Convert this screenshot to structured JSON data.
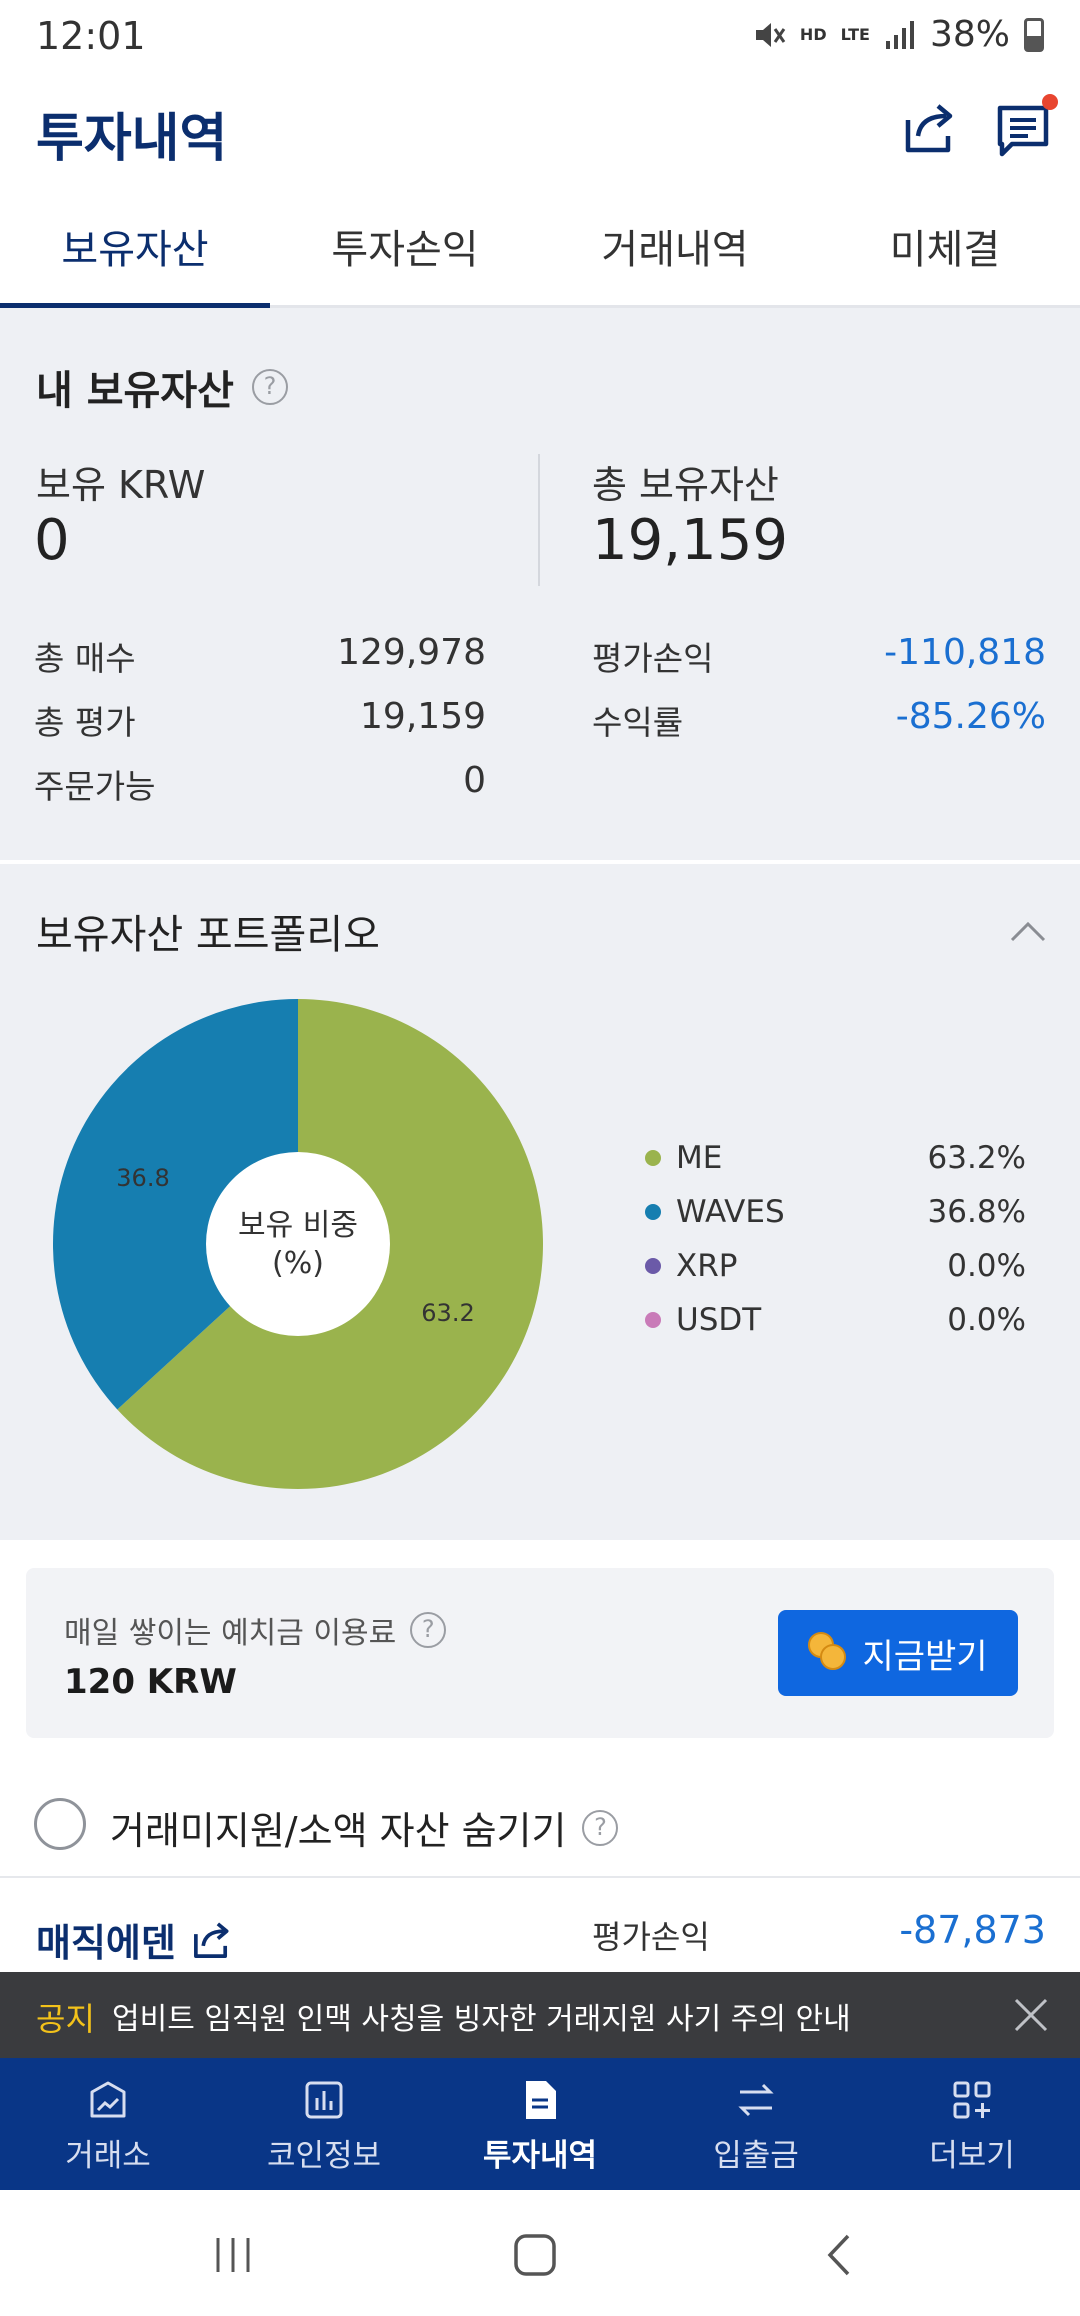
{
  "status_bar": {
    "time": "12:01",
    "network_hd": "HD",
    "network_lte": "LTE",
    "battery": "38%"
  },
  "header": {
    "title": "투자내역",
    "share_icon": "share-icon",
    "notice_icon": "notice-list-icon"
  },
  "tabs": [
    {
      "label": "보유자산",
      "active": true
    },
    {
      "label": "투자손익",
      "active": false
    },
    {
      "label": "거래내역",
      "active": false
    },
    {
      "label": "미체결",
      "active": false
    }
  ],
  "holdings": {
    "title": "내 보유자산",
    "help": "?",
    "krw_label": "보유 KRW",
    "krw_value": "0",
    "total_label": "총 보유자산",
    "total_value": "19,159",
    "rows_left": [
      {
        "label": "총 매수",
        "value": "129,978"
      },
      {
        "label": "총 평가",
        "value": "19,159"
      },
      {
        "label": "주문가능",
        "value": "0"
      }
    ],
    "rows_right": [
      {
        "label": "평가손익",
        "value": "-110,818"
      },
      {
        "label": "수익률",
        "value": "-85.26%"
      }
    ]
  },
  "portfolio": {
    "title": "보유자산 포트폴리오",
    "center_label_1": "보유 비중",
    "center_label_2": "(%)",
    "slice_label_me": "63.2",
    "slice_label_waves": "36.8",
    "legend": [
      {
        "name": "ME",
        "pct": "63.2%",
        "color": "#9ab34d"
      },
      {
        "name": "WAVES",
        "pct": "36.8%",
        "color": "#167eb0"
      },
      {
        "name": "XRP",
        "pct": "0.0%",
        "color": "#6b5aa8"
      },
      {
        "name": "USDT",
        "pct": "0.0%",
        "color": "#c97bb8"
      }
    ]
  },
  "chart_data": {
    "type": "pie",
    "title": "보유자산 포트폴리오",
    "categories": [
      "ME",
      "WAVES",
      "XRP",
      "USDT"
    ],
    "values": [
      63.2,
      36.8,
      0.0,
      0.0
    ],
    "colors": [
      "#9ab34d",
      "#167eb0",
      "#6b5aa8",
      "#c97bb8"
    ],
    "center_text": "보유 비중 (%)",
    "legend_position": "right"
  },
  "fee_card": {
    "text": "매일 쌓이는 예치금 이용료",
    "amount": "120 KRW",
    "button_label": "지금받기",
    "help": "?"
  },
  "hide_small": {
    "label": "거래미지원/소액 자산 숨기기",
    "help": "?",
    "checked": false
  },
  "asset_row": {
    "name": "매직에덴",
    "pl_label": "평가손익",
    "pl_value": "-87,873"
  },
  "notice": {
    "tag": "공지",
    "text": "업비트 임직원 인맥 사칭을 빙자한 거래지원 사기 주의 안내"
  },
  "bottom_nav": [
    {
      "label": "거래소",
      "icon": "exchange-chart-icon",
      "active": false
    },
    {
      "label": "코인정보",
      "icon": "bar-chart-icon",
      "active": false
    },
    {
      "label": "투자내역",
      "icon": "document-icon",
      "active": true
    },
    {
      "label": "입출금",
      "icon": "transfer-arrows-icon",
      "active": false
    },
    {
      "label": "더보기",
      "icon": "more-grid-icon",
      "active": false
    }
  ]
}
